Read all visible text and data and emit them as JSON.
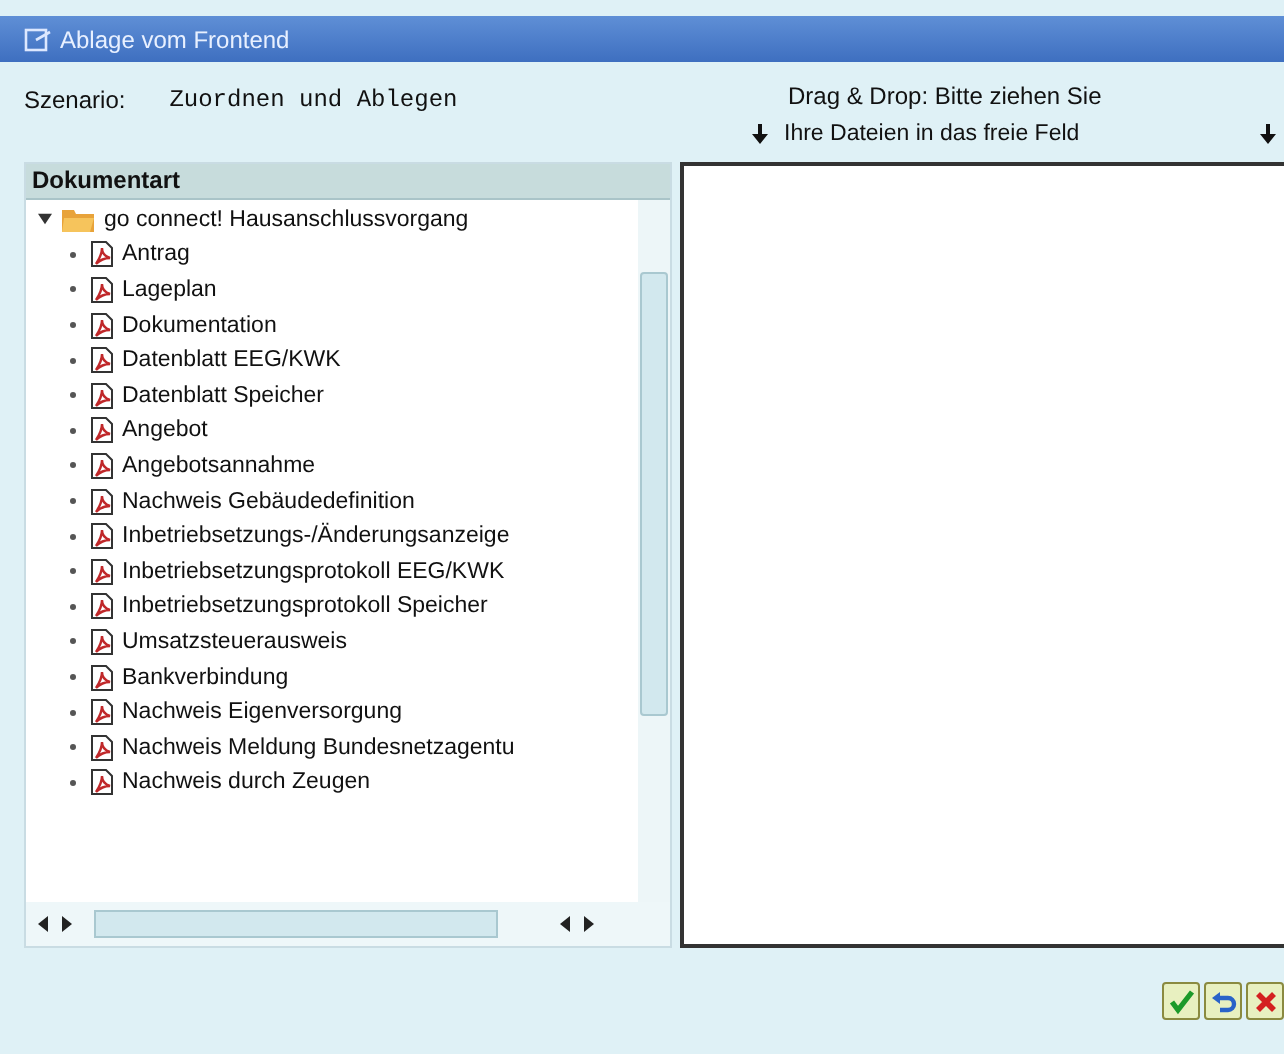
{
  "window": {
    "title": "Ablage vom Frontend"
  },
  "scenario": {
    "label": "Szenario:",
    "value": "Zuordnen und Ablegen"
  },
  "drop_hint": {
    "line_1": "Drag & Drop: Bitte ziehen Sie",
    "line_2": "Ihre Dateien in das freie Feld"
  },
  "tree": {
    "header": "Dokumentart",
    "items": [
      {
        "label": "go connect! Hausanschlussvorgang",
        "expanded": true,
        "children": [
          {
            "label": "Antrag"
          },
          {
            "label": "Lageplan"
          },
          {
            "label": "Dokumentation"
          },
          {
            "label": "Datenblatt EEG/KWK"
          },
          {
            "label": "Datenblatt Speicher"
          },
          {
            "label": "Angebot"
          },
          {
            "label": "Angebotsannahme"
          },
          {
            "label": "Nachweis Gebäudedefinition"
          },
          {
            "label": "Inbetriebsetzungs-/Änderungsanzeige"
          },
          {
            "label": "Inbetriebsetzungsprotokoll EEG/KWK"
          },
          {
            "label": "Inbetriebsetzungsprotokoll Speicher"
          },
          {
            "label": "Umsatzsteuerausweis"
          },
          {
            "label": "Bankverbindung"
          },
          {
            "label": "Nachweis Eigenversorgung"
          },
          {
            "label": "Nachweis Meldung Bundesnetzagentu"
          },
          {
            "label": "Nachweis durch Zeugen"
          }
        ]
      }
    ]
  },
  "buttons": [
    {
      "kind": "confirm"
    },
    {
      "kind": "undo"
    },
    {
      "kind": "cancel"
    }
  ]
}
